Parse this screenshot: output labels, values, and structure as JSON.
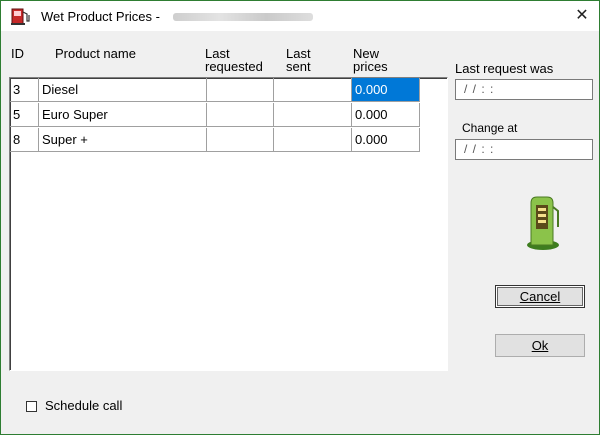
{
  "window": {
    "title": "Wet Product Prices  -",
    "close": "✕"
  },
  "grid": {
    "headers": {
      "id": "ID",
      "product": "Product name",
      "last_requested_1": "Last",
      "last_requested_2": "requested",
      "last_sent_1": "Last",
      "last_sent_2": "sent",
      "new_prices_1": "New",
      "new_prices_2": "prices"
    },
    "rows": [
      {
        "id": "3",
        "product": "Diesel",
        "last_requested": "",
        "last_sent": "",
        "new_price": "0.000"
      },
      {
        "id": "5",
        "product": "Euro Super",
        "last_requested": "",
        "last_sent": "",
        "new_price": "0.000"
      },
      {
        "id": "8",
        "product": "Super +",
        "last_requested": "",
        "last_sent": "",
        "new_price": "0.000"
      }
    ]
  },
  "side": {
    "last_request_label": "Last request was",
    "last_request_value": "/ /     : :",
    "change_at_label": "Change at",
    "change_at_value": "/ /     : :"
  },
  "buttons": {
    "cancel": "Cancel",
    "ok": "Ok"
  },
  "footer": {
    "schedule_call": "Schedule call"
  },
  "colors": {
    "selection": "#0078d7",
    "window_border": "#2e7d32",
    "pump_icon": "#7cb342",
    "app_icon": "#c62828"
  },
  "icons": {
    "app": "fuel-pump-red-icon",
    "pump": "fuel-pump-green-icon",
    "close": "close-icon"
  }
}
